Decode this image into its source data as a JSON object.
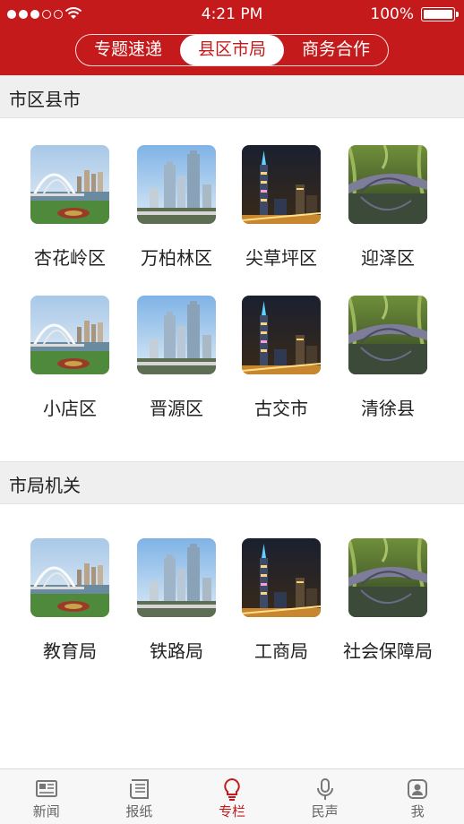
{
  "status_bar": {
    "time": "4:21 PM",
    "battery": "100%",
    "signal_filled": 3,
    "signal_total": 5
  },
  "segments": {
    "items": [
      "专题速递",
      "县区市局",
      "商务合作"
    ],
    "active_index": 1
  },
  "sections": [
    {
      "title": "市区县市",
      "items": [
        {
          "label": "杏花岭区",
          "thumb": "bridge-arch-photo"
        },
        {
          "label": "万柏林区",
          "thumb": "skyscrapers-photo"
        },
        {
          "label": "尖草坪区",
          "thumb": "night-city-photo"
        },
        {
          "label": "迎泽区",
          "thumb": "stone-bridge-photo"
        },
        {
          "label": "小店区",
          "thumb": "bridge-arch-photo"
        },
        {
          "label": "晋源区",
          "thumb": "skyscrapers-photo"
        },
        {
          "label": "古交市",
          "thumb": "night-city-photo"
        },
        {
          "label": "清徐县",
          "thumb": "stone-bridge-photo"
        }
      ]
    },
    {
      "title": "市局机关",
      "items": [
        {
          "label": "教育局",
          "thumb": "bridge-arch-photo"
        },
        {
          "label": "铁路局",
          "thumb": "skyscrapers-photo"
        },
        {
          "label": "工商局",
          "thumb": "night-city-photo"
        },
        {
          "label": "社会保障局",
          "thumb": "stone-bridge-photo"
        }
      ]
    }
  ],
  "tabbar": {
    "items": [
      {
        "label": "新闻",
        "icon": "newspaper-icon"
      },
      {
        "label": "报纸",
        "icon": "paper-icon"
      },
      {
        "label": "专栏",
        "icon": "lightbulb-icon"
      },
      {
        "label": "民声",
        "icon": "microphone-icon"
      },
      {
        "label": "我",
        "icon": "user-icon"
      }
    ],
    "active_index": 2
  },
  "colors": {
    "brand_red": "#c51a1c",
    "section_bg": "#efefef",
    "tab_inactive": "#666666"
  }
}
